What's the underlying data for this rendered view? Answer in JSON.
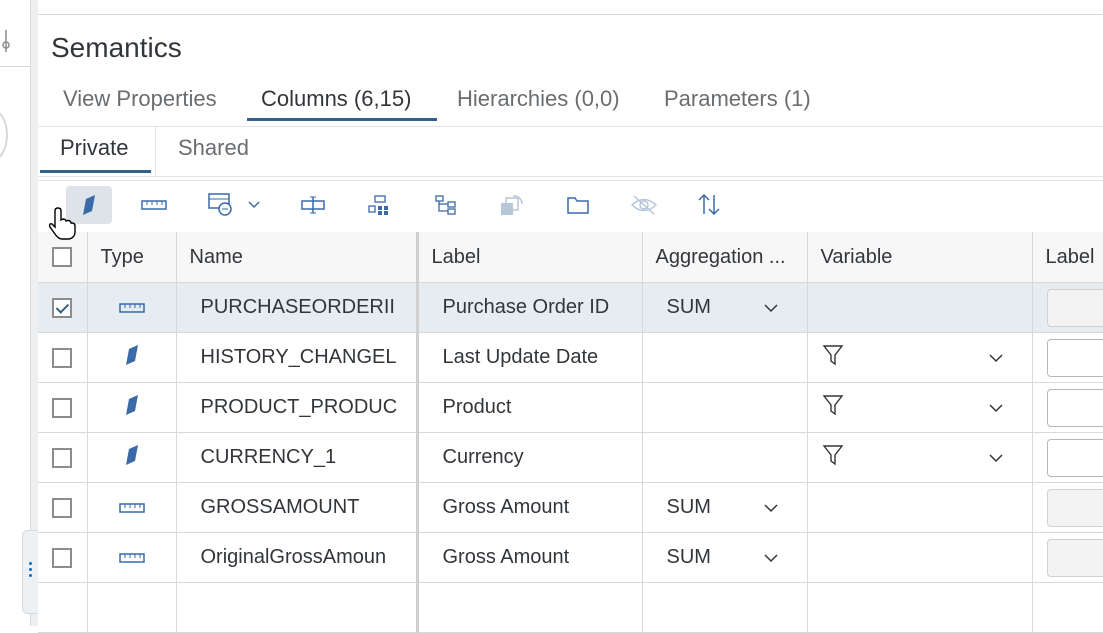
{
  "page_title": "Semantics",
  "main_tabs": [
    {
      "label": "View Properties"
    },
    {
      "label": "Columns (6,15)"
    },
    {
      "label": "Hierarchies (0,0)"
    },
    {
      "label": "Parameters (1)"
    }
  ],
  "sub_tabs": [
    {
      "label": "Private"
    },
    {
      "label": "Shared"
    }
  ],
  "toolbar_icons": [
    "attribute-icon",
    "measure-icon",
    "calculated-column-icon",
    "rename-icon",
    "hierarchy-icon",
    "tree-icon",
    "swap-icon",
    "folder-icon",
    "hide-icon",
    "sort-icon"
  ],
  "table": {
    "headers": {
      "type": "Type",
      "name": "Name",
      "label": "Label",
      "aggregation": "Aggregation ...",
      "variable": "Variable",
      "label_column": "Label"
    },
    "rows": [
      {
        "checked": true,
        "type": "measure",
        "name": "PURCHASEORDERII",
        "label": "Purchase Order ID",
        "aggregation": "SUM",
        "variable": false
      },
      {
        "checked": false,
        "type": "attribute",
        "name": "HISTORY_CHANGEL",
        "label": "Last Update Date",
        "aggregation": "",
        "variable": true
      },
      {
        "checked": false,
        "type": "attribute",
        "name": "PRODUCT_PRODUC",
        "label": "Product",
        "aggregation": "",
        "variable": true
      },
      {
        "checked": false,
        "type": "attribute",
        "name": "CURRENCY_1",
        "label": "Currency",
        "aggregation": "",
        "variable": true
      },
      {
        "checked": false,
        "type": "measure",
        "name": "GROSSAMOUNT",
        "label": "Gross Amount",
        "aggregation": "SUM",
        "variable": false
      },
      {
        "checked": false,
        "type": "measure",
        "name": "OriginalGrossAmoun",
        "label": "Gross Amount",
        "aggregation": "SUM",
        "variable": false
      }
    ]
  },
  "colors": {
    "accent": "#346187",
    "icon_blue": "#3a6aa8",
    "selected_row": "#e5ecf2"
  }
}
